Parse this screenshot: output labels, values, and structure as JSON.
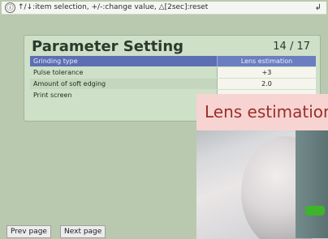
{
  "topbar": {
    "info_symbol": "ⓘ",
    "help_text": "↑/↓:item selection, +/-:change value, △[2sec]:reset",
    "enter_symbol": "↲"
  },
  "panel": {
    "title": "Parameter Setting",
    "page_counter": "14 / 17",
    "rows": [
      {
        "label": "Grinding type",
        "value": "Lens estimation"
      },
      {
        "label": "Pulse tolerance",
        "value": "+3"
      },
      {
        "label": "Amount of soft edging",
        "value": "2.0"
      },
      {
        "label": "Print screen",
        "value": ""
      }
    ]
  },
  "lens_popup": {
    "banner_text": "Lens estimation"
  },
  "footer": {
    "prev_label": "Prev page",
    "next_label": "Next page"
  },
  "colors": {
    "background": "#b9c9b0",
    "panel_bg": "#cfe0c8",
    "selection": "#5c6fb2",
    "banner_bg": "#f7d4d2",
    "banner_text": "#9a2f2a"
  }
}
